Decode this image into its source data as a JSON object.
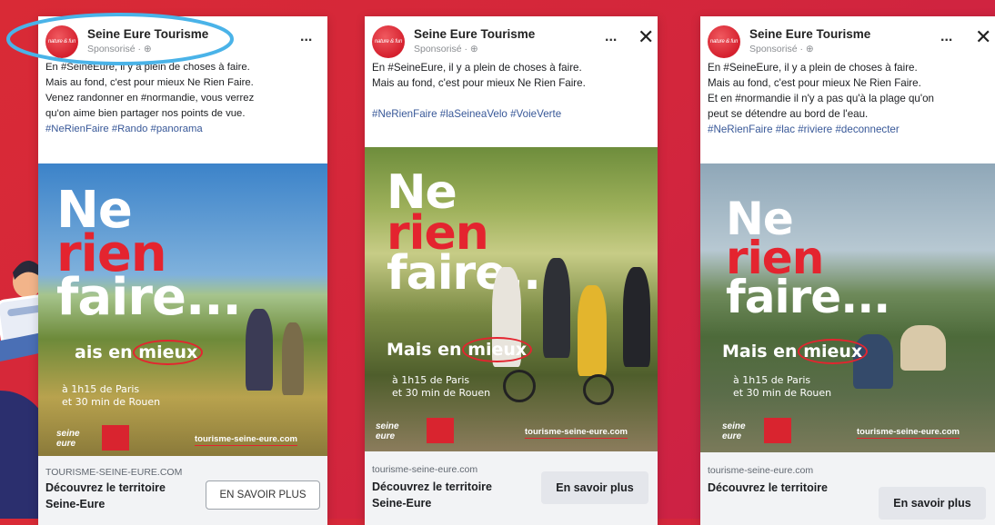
{
  "ads": [
    {
      "page_name": "Seine Eure Tourisme",
      "sponsored": "Sponsorisé · ⊕",
      "avatar_text": "nature & fun",
      "menu": "...",
      "text_lines": [
        "En #SeineEure, il y a plein de choses à faire.",
        "Mais au fond, c'est pour mieux Ne Rien Faire.",
        "Venez randonner en #normandie, vous verrez",
        "qu'on aime bien partager nos points de vue.",
        "#NeRienFaire #Rando #panorama"
      ],
      "headline": [
        "Ne",
        "rien",
        "faire..."
      ],
      "tagline_a": "ais en ",
      "tagline_b": "mieux",
      "sub1": "à 1h15 de Paris",
      "sub2": "et 30 min de Rouen",
      "logo": "seine eure",
      "img_url": "tourisme-seine-eure.com",
      "link_domain": "TOURISME-SEINE-EURE.COM",
      "link_title": [
        "Découvrez le territoire",
        "Seine-Eure"
      ],
      "cta": "EN SAVOIR PLUS"
    },
    {
      "page_name": "Seine Eure Tourisme",
      "sponsored": "Sponsorisé · ⊕",
      "avatar_text": "nature & fun",
      "menu": "...",
      "close": "✕",
      "text_lines": [
        "En #SeineEure, il y a plein de choses à faire.",
        "Mais au fond, c'est pour mieux Ne Rien Faire."
      ],
      "tags": "#NeRienFaire #laSeineaVelo #VoieVerte",
      "headline": [
        "Ne",
        "rien",
        "faire..."
      ],
      "tagline_a": "Mais en ",
      "tagline_b": "mieux",
      "sub1": "à 1h15 de Paris",
      "sub2": "et 30 min de Rouen",
      "logo": "seine eure",
      "img_url": "tourisme-seine-eure.com",
      "link_domain": "tourisme-seine-eure.com",
      "link_title": [
        "Découvrez le territoire",
        "Seine-Eure"
      ],
      "cta": "En savoir plus"
    },
    {
      "page_name": "Seine Eure Tourisme",
      "sponsored": "Sponsorisé · ⊕",
      "avatar_text": "nature & fun",
      "menu": "...",
      "close": "✕",
      "text_lines": [
        "En #SeineEure, il y a plein de choses à faire.",
        "Mais au fond, c'est pour mieux Ne Rien Faire.",
        "Et en #normandie il n'y a pas qu'à la plage qu'on",
        "peut se détendre au bord de l'eau.",
        "#NeRienFaire #lac #riviere #deconnecter"
      ],
      "headline": [
        "Ne",
        "rien",
        "faire..."
      ],
      "tagline_a": "Mais en ",
      "tagline_b": "mieux",
      "sub1": "à 1h15 de Paris",
      "sub2": "et 30 min de Rouen",
      "logo": "seine eure",
      "img_url": "tourisme-seine-eure.com",
      "link_domain": "tourisme-seine-eure.com",
      "link_title": [
        "Découvrez le territoire"
      ],
      "cta": "En savoir plus"
    }
  ],
  "colors": {
    "background": "#d92a36",
    "brand_red": "#e4242f",
    "highlight_ring": "#4ab3e8",
    "hashtag": "#385898"
  }
}
